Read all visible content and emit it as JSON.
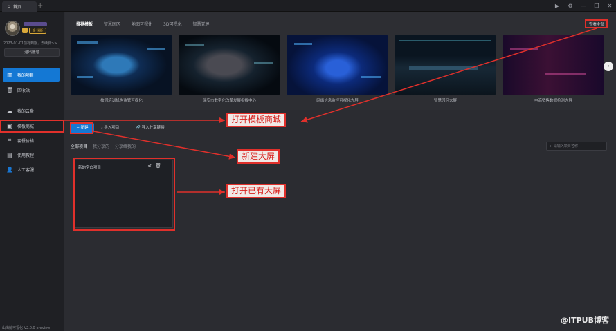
{
  "titlebar": {
    "tab_label": "首页",
    "tab_icon": "home-icon",
    "add_tab": "+"
  },
  "window_controls": [
    "▶",
    "⚙",
    "—",
    "❐",
    "✕"
  ],
  "user": {
    "badge": "企业版",
    "expire_text": "2023-01-01前有到期，去续费>>",
    "logout": "退出账号"
  },
  "sidebar": {
    "items": [
      {
        "label": "我的项目",
        "icon": "chart-icon",
        "active": true
      },
      {
        "label": "回收站",
        "icon": "trash-icon"
      },
      {
        "label": "我的云盘",
        "icon": "cloud-icon"
      },
      {
        "label": "模板商城",
        "icon": "store-icon"
      },
      {
        "label": "套餐价格",
        "icon": "tag-icon"
      },
      {
        "label": "使用教程",
        "icon": "book-icon"
      },
      {
        "label": "人工客服",
        "icon": "person-icon"
      }
    ],
    "version": "山海鲸可视化 V2.0.0-preview"
  },
  "templates": {
    "tabs": [
      "推荐模板",
      "智慧园区",
      "地图可视化",
      "3D可视化",
      "智慧党建"
    ],
    "see_all": "查看全部",
    "cards": [
      {
        "caption": "校园培训机构监管可视化"
      },
      {
        "caption": "瑞安市数字化改革发展指挥中心"
      },
      {
        "caption": "网络信息监控可视化大屏"
      },
      {
        "caption": "智慧园区大屏"
      },
      {
        "caption": "电商销售数据检测大屏"
      }
    ],
    "next_icon": "›"
  },
  "projects": {
    "new_button": "+ 新建",
    "import_button": "导入项目",
    "import_link_button": "导入分享链接",
    "tabs": [
      "全部项目",
      "我分享的",
      "分享给我的"
    ],
    "search_placeholder": "请输入项目名称",
    "card_name": "新的空白项目"
  },
  "annotations": {
    "open_store": "打开模板商城",
    "new_screen": "新建大屏",
    "open_existing": "打开已有大屏"
  },
  "watermark": "@ITPUB博客",
  "colors": {
    "accent": "#1478d4",
    "annotation_red": "#e0302b",
    "vip_gold": "#d9a83a"
  }
}
